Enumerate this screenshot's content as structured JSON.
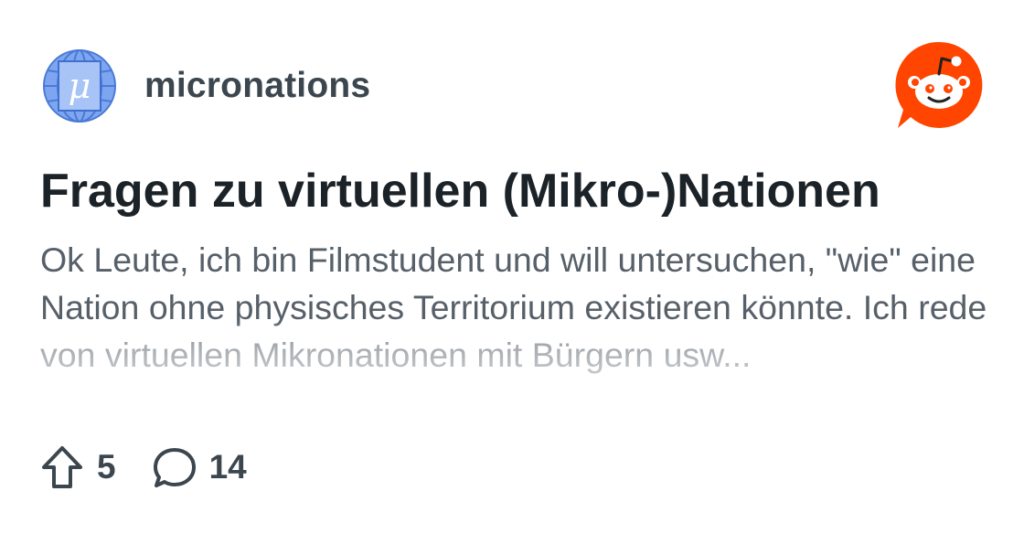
{
  "subreddit": {
    "name": "micronations",
    "avatar_icon": "micronations-mu-globe-icon",
    "avatar_letter": "μ"
  },
  "brand": {
    "logo_icon": "reddit-snoo-logo-icon",
    "accent_color": "#ff4500"
  },
  "post": {
    "title": "Fragen zu virtuellen (Mikro-)Nationen",
    "body": "Ok Leute, ich bin Filmstudent und will untersuchen, \"wie\" eine Nation ohne physisches Territorium existieren könnte. Ich rede von virtuellen Mikronationen mit Bürgern usw..."
  },
  "stats": {
    "upvote_icon": "upvote-arrow-icon",
    "upvotes": "5",
    "comment_icon": "comment-bubble-icon",
    "comments": "14"
  }
}
